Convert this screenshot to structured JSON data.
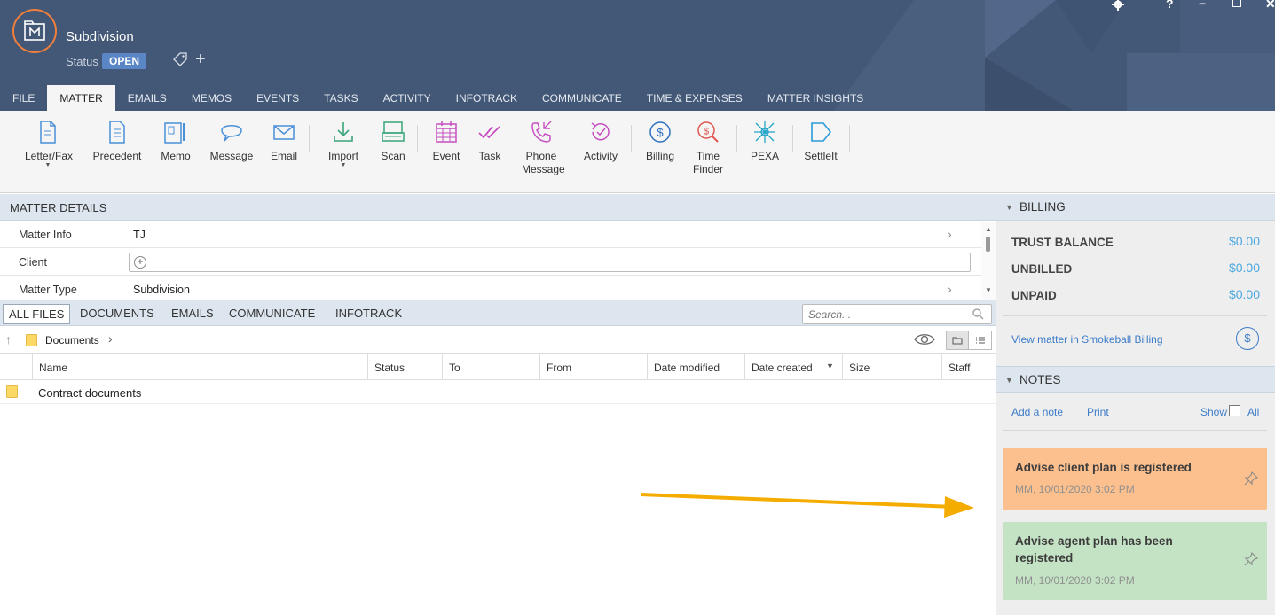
{
  "header": {
    "matter_title": "Subdivision",
    "status_label": "Status",
    "status_value": "OPEN",
    "accent_color": "#f07f3c",
    "window_controls": [
      "gear-icon",
      "help-icon",
      "minimize-icon",
      "maximize-icon",
      "close-icon"
    ],
    "help_glyph": "?",
    "minimize_glyph": "−",
    "close_glyph": "✕"
  },
  "menu": {
    "tabs": [
      "FILE",
      "MATTER",
      "EMAILS",
      "MEMOS",
      "EVENTS",
      "TASKS",
      "ACTIVITY",
      "INFOTRACK",
      "COMMUNICATE",
      "TIME & EXPENSES",
      "MATTER INSIGHTS"
    ],
    "active": "MATTER"
  },
  "ribbon": {
    "letter_fax": "Letter/Fax",
    "precedent": "Precedent",
    "memo": "Memo",
    "message": "Message",
    "email": "Email",
    "import": "Import",
    "scan": "Scan",
    "event": "Event",
    "task": "Task",
    "phone_message_1": "Phone",
    "phone_message_2": "Message",
    "activity": "Activity",
    "billing": "Billing",
    "time_finder_1": "Time",
    "time_finder_2": "Finder",
    "pexa": "PEXA",
    "settleit": "SettleIt",
    "caret": "▼"
  },
  "matter_details": {
    "title": "MATTER DETAILS",
    "rows": [
      {
        "label": "Matter Info",
        "value": "TJ"
      },
      {
        "label": "Client",
        "value": ""
      },
      {
        "label": "Matter Type",
        "value": "Subdivision"
      }
    ],
    "chevron": "›",
    "client_plus": "+",
    "scroll_up": "▲",
    "scroll_down": "▼"
  },
  "files": {
    "tabs": [
      "ALL FILES",
      "DOCUMENTS",
      "EMAILS",
      "COMMUNICATE",
      "INFOTRACK"
    ],
    "active_tab": "ALL FILES",
    "search_placeholder": "Search...",
    "breadcrumb": "Documents",
    "up_glyph": "↑",
    "crumb_sep": "›",
    "sort_glyph": "▼",
    "columns": [
      "Name",
      "Status",
      "To",
      "From",
      "Date modified",
      "Date created",
      "Size",
      "Staff"
    ],
    "sorted_column": "Date created",
    "rows": [
      {
        "name": "Contract documents",
        "type": "folder"
      }
    ]
  },
  "billing": {
    "title": "BILLING",
    "collapse_glyph": "▼",
    "items": [
      {
        "label": "TRUST BALANCE",
        "value": "$0.00"
      },
      {
        "label": "UNBILLED",
        "value": "$0.00"
      },
      {
        "label": "UNPAID",
        "value": "$0.00"
      }
    ],
    "link": "View matter in Smokeball Billing",
    "dollar_glyph": "$",
    "value_color": "#49a7e0"
  },
  "notes": {
    "title": "NOTES",
    "collapse_glyph": "▼",
    "add_note": "Add a note",
    "print": "Print",
    "show": "Show",
    "all": "All",
    "items": [
      {
        "title": "Advise client plan is registered",
        "meta": "MM, 10/01/2020 3:02 PM",
        "color": "#fcc08f"
      },
      {
        "title": "Advise agent plan has been registered",
        "meta": "MM, 10/01/2020 3:02 PM",
        "color": "#c4e3c5"
      }
    ]
  }
}
